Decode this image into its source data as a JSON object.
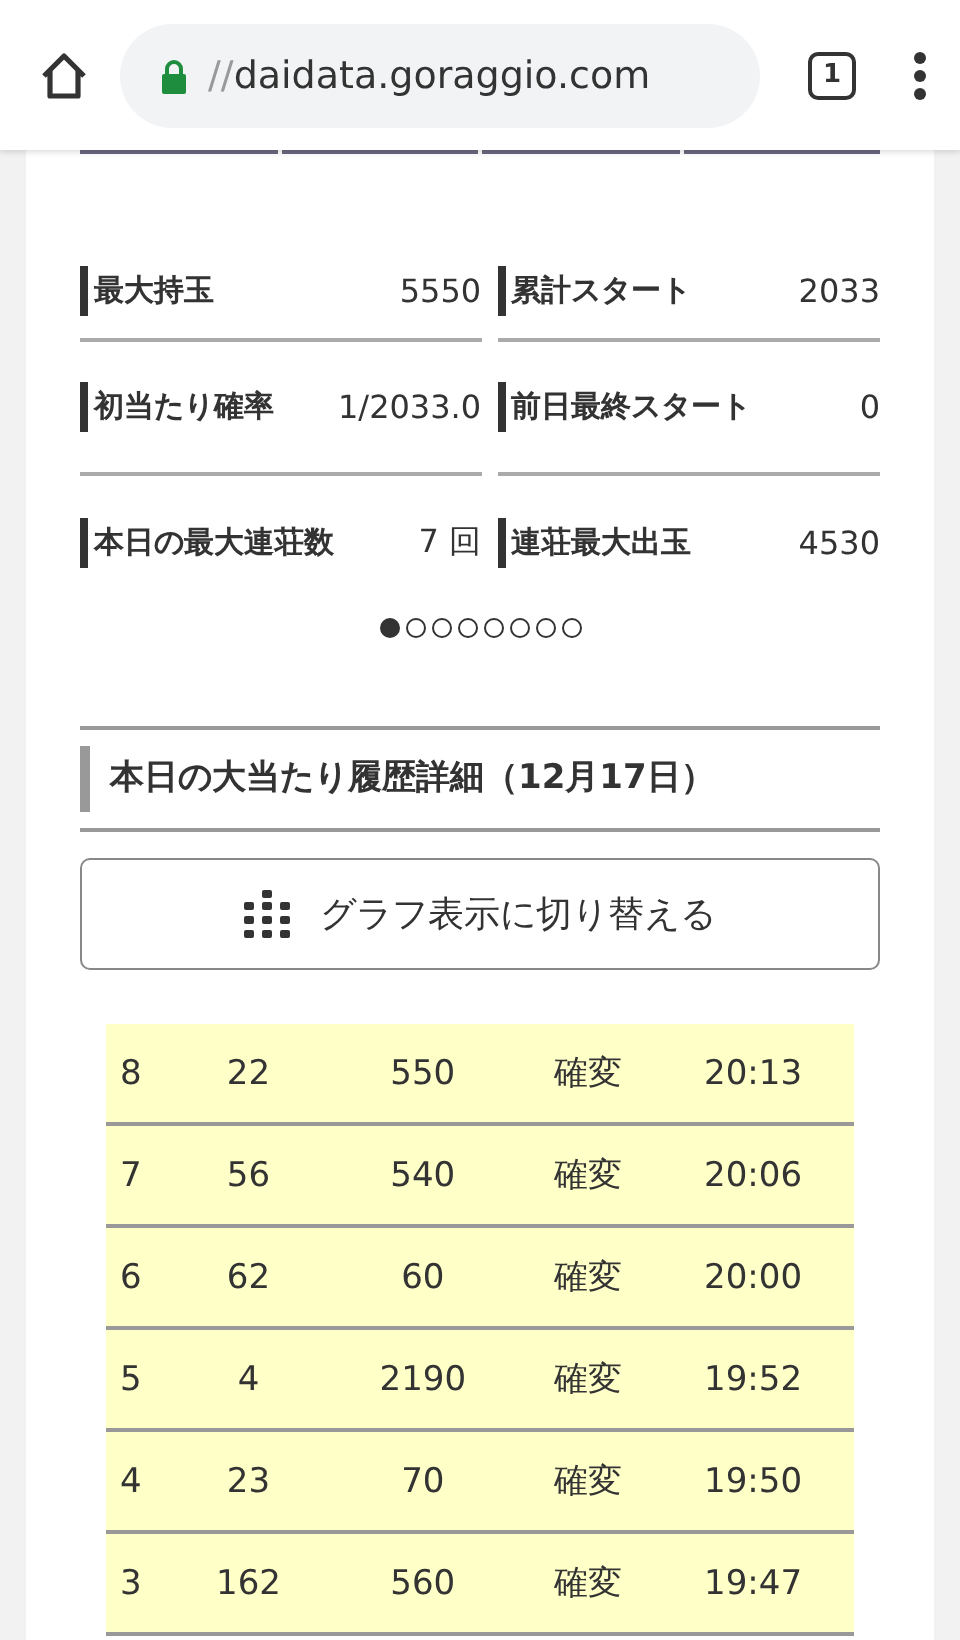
{
  "browser": {
    "url_scheme": "//",
    "url_host": "daidata.goraggio.com",
    "tab_count": "1"
  },
  "stats": [
    {
      "label": "最大持玉",
      "value": "5550"
    },
    {
      "label": "累計スタート",
      "value": "2033"
    },
    {
      "label": "初当たり確率",
      "value": "1/2033.0"
    },
    {
      "label": "前日最終スタート",
      "value": "0"
    },
    {
      "label": "本日の最大連荘数",
      "value": "7 回"
    },
    {
      "label": "連荘最大出玉",
      "value": "4530"
    }
  ],
  "pager": [
    {
      "selected": true
    },
    {
      "selected": false
    },
    {
      "selected": false
    },
    {
      "selected": false
    },
    {
      "selected": false
    },
    {
      "selected": false
    },
    {
      "selected": false
    },
    {
      "selected": false
    }
  ],
  "section_title": "本日の大当たり履歴詳細（12月17日）",
  "toggle_button": "グラフ表示に切り替える",
  "history": {
    "rows": [
      [
        "8",
        "22",
        "550",
        "確変",
        "20:13"
      ],
      [
        "7",
        "56",
        "540",
        "確変",
        "20:06"
      ],
      [
        "6",
        "62",
        "60",
        "確変",
        "20:00"
      ],
      [
        "5",
        "4",
        "2190",
        "確変",
        "19:52"
      ],
      [
        "4",
        "23",
        "70",
        "確変",
        "19:50"
      ],
      [
        "3",
        "162",
        "560",
        "確変",
        "19:47"
      ]
    ]
  }
}
